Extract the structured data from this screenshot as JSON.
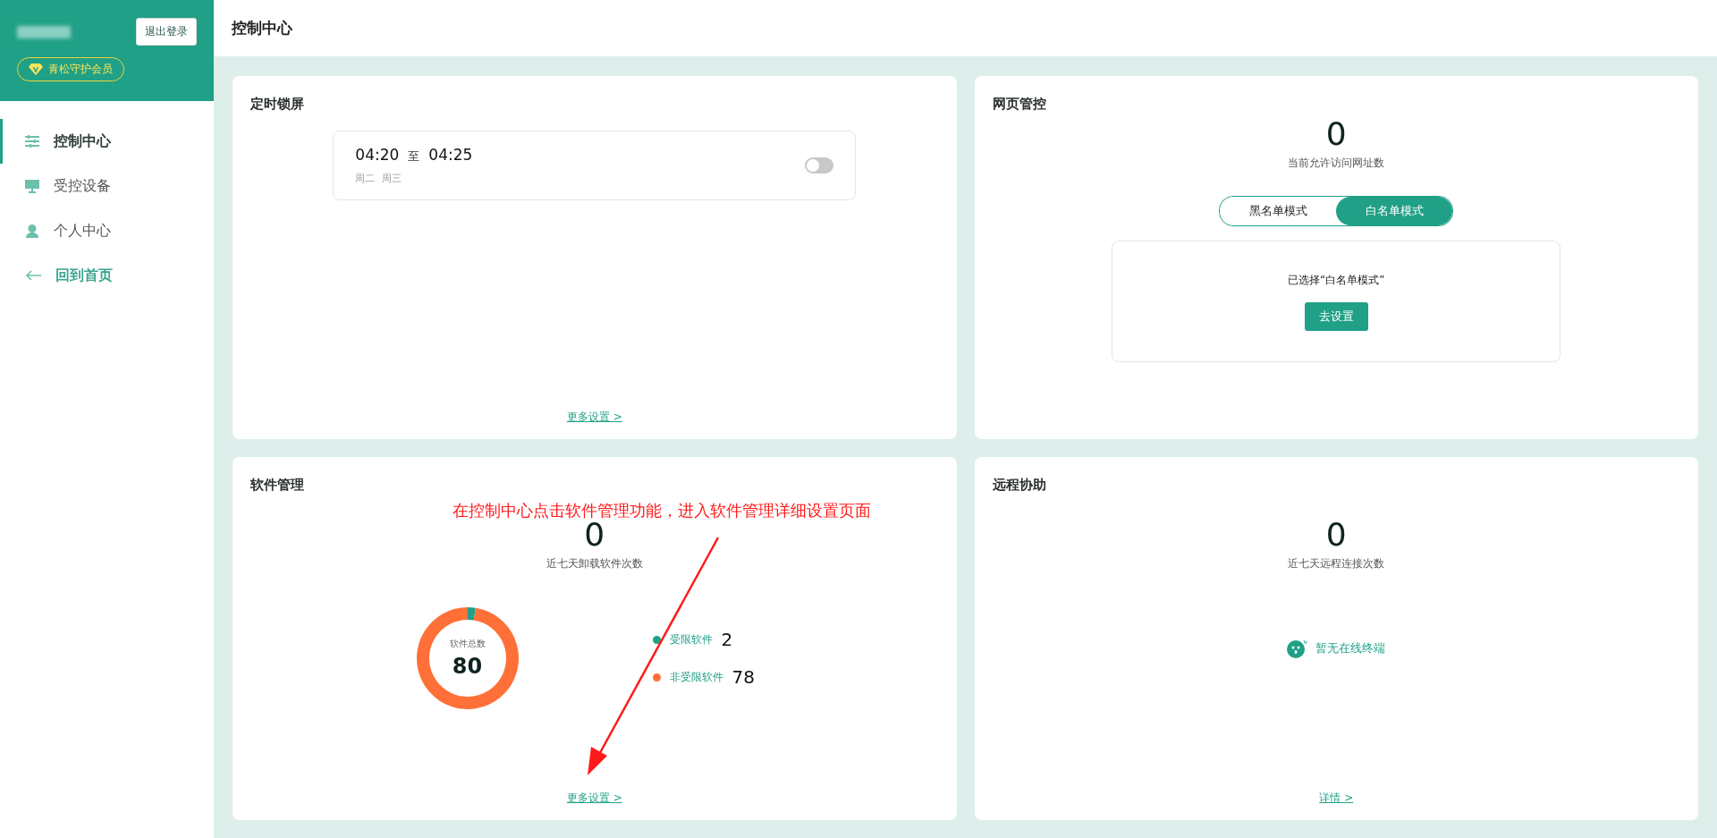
{
  "sidebar": {
    "logout_button": "退出登录",
    "member_badge": "青松守护会员",
    "items": [
      {
        "label": "控制中心",
        "kind": "nav",
        "selected": true
      },
      {
        "label": "受控设备",
        "kind": "nav",
        "selected": false
      },
      {
        "label": "个人中心",
        "kind": "nav",
        "selected": false
      },
      {
        "label": "回到首页",
        "kind": "back",
        "selected": false
      }
    ]
  },
  "header": {
    "title": "控制中心"
  },
  "lock_card": {
    "title": "定时锁屏",
    "schedules": [
      {
        "start": "04:20",
        "separator": "至",
        "end": "04:25",
        "days": [
          "周二",
          "周三"
        ],
        "on": false
      }
    ],
    "more_link": "更多设置 >"
  },
  "web_card": {
    "title": "网页管控",
    "count": "0",
    "count_label": "当前允许访问网址数",
    "modes": [
      {
        "label": "黑名单模式",
        "selected": false
      },
      {
        "label": "白名单模式",
        "selected": true
      }
    ],
    "status": "已选择“白名单模式”",
    "button": "去设置"
  },
  "software_card": {
    "title": "软件管理",
    "count": "0",
    "count_label": "近七天卸载软件次数",
    "total_label": "软件总数",
    "total": "80",
    "chart_data": {
      "type": "donut",
      "categories": [
        "受限软件",
        "非受限软件"
      ],
      "values": [
        2.5,
        97.5
      ]
    },
    "legend": [
      {
        "value": "2",
        "color": "#20a086"
      },
      {
        "value": "78",
        "color": "#ff7038"
      }
    ],
    "more_link": "更多设置 >"
  },
  "remote_card": {
    "title": "远程协助",
    "count": "0",
    "count_label": "近七天远程连接次数",
    "empty_text": "暂无在线终端",
    "details_link": "详情 >"
  },
  "annotation": {
    "text": "在控制中心点击软件管理功能，进入软件管理详细设置页面"
  }
}
